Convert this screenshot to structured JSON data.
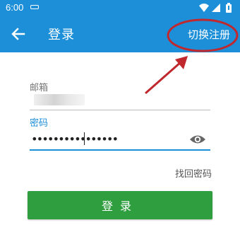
{
  "status_bar": {
    "time": "6:00",
    "icons": [
      "notification-icon",
      "wifi-icon",
      "signal-icon",
      "battery-icon"
    ]
  },
  "app_bar": {
    "back_icon": "arrow-left-icon",
    "title": "登录",
    "action_label": "切换注册"
  },
  "form": {
    "email_label": "邮箱",
    "email_value": "",
    "password_label": "密码",
    "password_value": "••••••••••••••••",
    "password_visibility_icon": "eye-icon",
    "forgot_password_label": "找回密码"
  },
  "login_button_label": "登录",
  "colors": {
    "primary": "#1d8fd8",
    "button": "#2e9e3e",
    "annotation": "#c0282e"
  }
}
